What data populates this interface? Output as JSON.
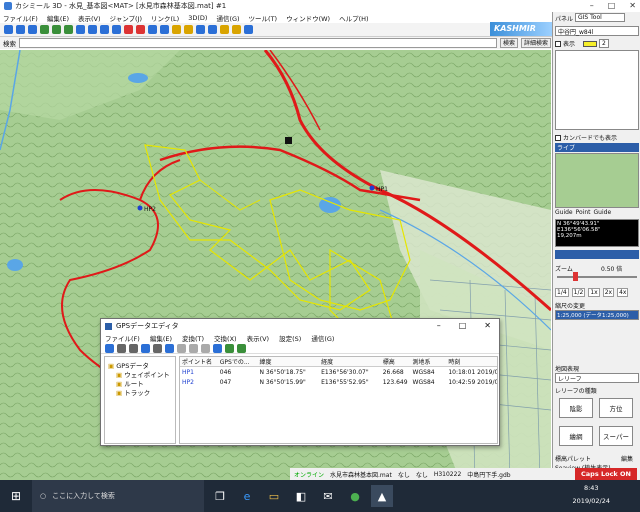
{
  "window": {
    "title": "カシミール 3D - 水見_基本図<MAT> [水見市森林基本図.mat] #1",
    "min": "–",
    "max": "□",
    "close": "✕"
  },
  "menu": [
    "ファイル(F)",
    "編集(E)",
    "表示(V)",
    "ジャンプ(J)",
    "リンク(L)",
    "3D(D)",
    "通信(G)",
    "ツール(T)",
    "ウィンドウ(W)",
    "ヘルプ(H)"
  ],
  "logo": "KASHMIR",
  "search": {
    "label": "検索",
    "value": "",
    "btn_search": "検索",
    "btn_detail": "詳細検索"
  },
  "map": {
    "waypoint1": "HP1",
    "waypoint2": "HP2"
  },
  "panel": {
    "title": "パネル",
    "tool": "GIS Tool",
    "layer_name": "中谷円_w84l",
    "show_label": "表示",
    "num": "2",
    "canvas_label": "カンバードでも表示",
    "route_label": "ライブ",
    "coord1": "N 36°49'43.91\"",
    "coord2": "E136°56'06.58\"",
    "coord3": "19,207m",
    "guide_items": [
      "Guide",
      "Point",
      "Guide"
    ],
    "zoom_label": "ズーム",
    "zoom_value": "0.50 倍",
    "scales": [
      "1/4",
      "1/2",
      "1x",
      "2x",
      "4x"
    ],
    "scale_change": "縮尺の変更",
    "scale_select": "1:25,000 (データ1:25,000)",
    "display_section": "地図表現",
    "relief_label": "レリーフ",
    "relief_type": "レリーフの種類",
    "btn_hatch": "陰影",
    "btn_dir": "方位",
    "btn_color": "繪網",
    "btn_super": "スーパー",
    "palette_label": "標高パレット",
    "palette_edit": "編集",
    "palette_name": "Seaview (植生表示)"
  },
  "gps": {
    "title": "GPSデータエディタ",
    "menu": [
      "ファイル(F)",
      "編集(E)",
      "変換(T)",
      "交換(X)",
      "表示(V)",
      "設定(S)",
      "通信(G)"
    ],
    "tree": [
      "GPSデータ",
      "ウェイポイント",
      "ルート",
      "トラック"
    ],
    "columns": [
      "ポイント名",
      "GPSでの...",
      "緯度",
      "経度",
      "標高",
      "測地系",
      "時刻"
    ],
    "rows": [
      [
        "HP1",
        "046",
        "N 36°50'18.75\"",
        "E136°56'30.07\"",
        "26.668",
        "WGS84",
        "10:18:01 2019/02/22"
      ],
      [
        "HP2",
        "047",
        "N 36°50'15.99\"",
        "E136°55'52.95\"",
        "123.649",
        "WGS84",
        "10:42:59 2019/02/22"
      ]
    ]
  },
  "status": {
    "online": "オンライン",
    "file": "水見市森林基本図.mat",
    "a": "なし",
    "b": "なし",
    "c": "H310222",
    "d": "中島円下手.gdb"
  },
  "caps": "Caps Lock ON",
  "taskbar": {
    "search_placeholder": "ここに入力して検索",
    "time": "8:43",
    "date": "2019/02/24"
  },
  "colors": {
    "route": "#e01919",
    "track": "#e6e600",
    "map_bg": "#9cc58a"
  }
}
